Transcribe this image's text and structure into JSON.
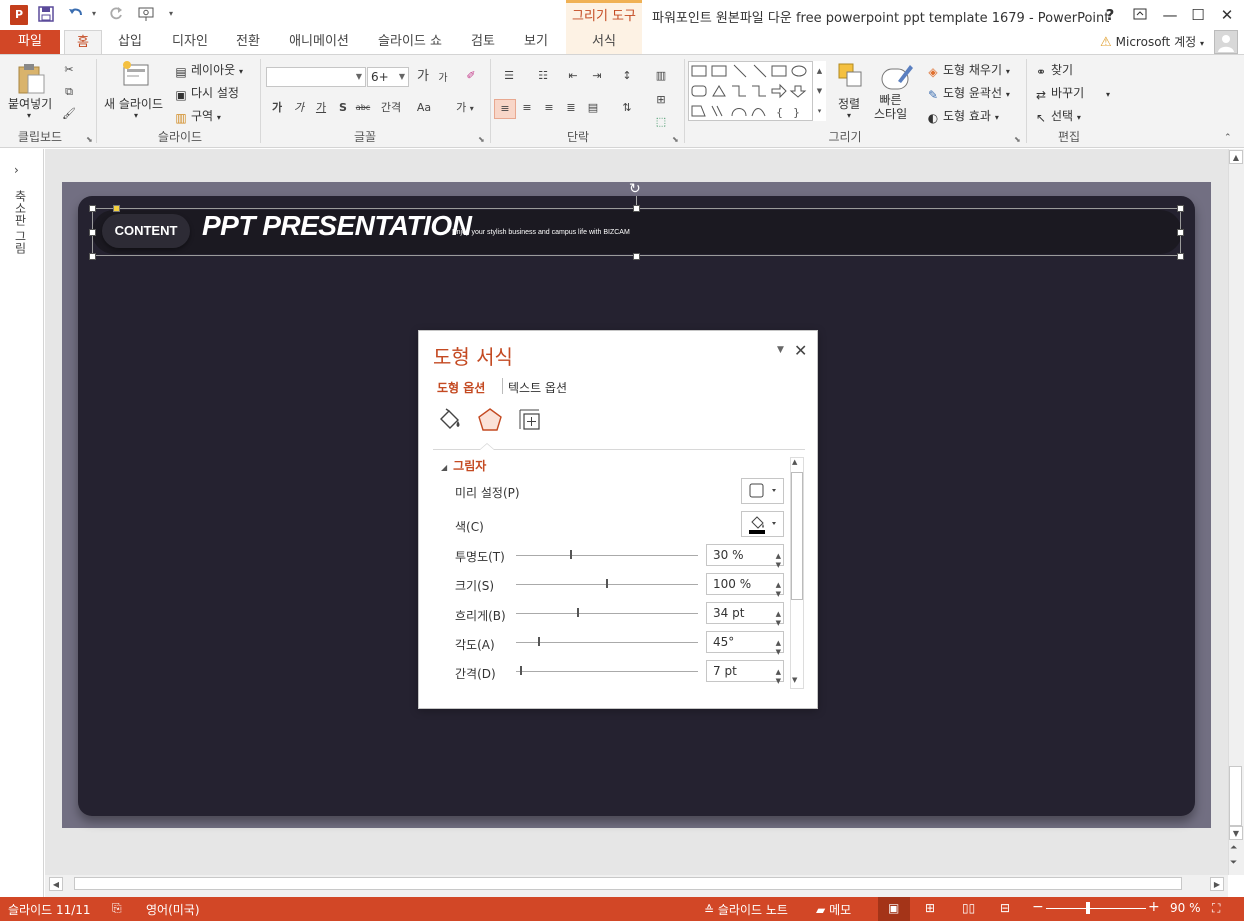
{
  "titlebar": {
    "app_logo": "P",
    "context_group": "그리기 도구",
    "window_title": "파워포인트 원본파일 다운 free powerpoint ppt template 1679 - PowerPoint",
    "help": "?",
    "restore_ribbon": "⧉",
    "minimize": "—",
    "maximize": "☐",
    "close": "✕"
  },
  "tabs": {
    "file": "파일",
    "home": "홈",
    "insert": "삽입",
    "design": "디자인",
    "transitions": "전환",
    "animations": "애니메이션",
    "slideshow": "슬라이드 쇼",
    "review": "검토",
    "view": "보기",
    "format": "서식",
    "account": "Microsoft 계정"
  },
  "ribbon": {
    "clipboard": {
      "paste": "붙여넣기",
      "label": "클립보드"
    },
    "slides": {
      "new_slide": "새 슬라이드",
      "layout": "레이아웃",
      "reset": "다시 설정",
      "section": "구역",
      "label": "슬라이드"
    },
    "font": {
      "font_name": "",
      "font_size": "6+",
      "grow": "가",
      "shrink": "가",
      "bold": "가",
      "italic": "가",
      "underline": "가",
      "shadow": "S",
      "strike": "abc",
      "spacing": "간격",
      "case": "Aa",
      "color": "가",
      "label": "글꼴"
    },
    "paragraph": {
      "label": "단락"
    },
    "drawing": {
      "arrange": "정렬",
      "quick_styles": "빠른\n스타일",
      "fill": "도형 채우기",
      "outline": "도형 윤곽선",
      "effects": "도형 효과",
      "label": "그리기"
    },
    "editing": {
      "find": "찾기",
      "replace": "바꾸기",
      "select": "선택",
      "label": "편집"
    }
  },
  "thumb_pane": {
    "toggle": "›",
    "label": "축소판 그림"
  },
  "slide": {
    "content_pill": "CONTENT",
    "title": "PPT PRESENTATION",
    "subtitle": "Enjoy your stylish business and campus life with BIZCAM"
  },
  "dialog": {
    "title": "도형 서식",
    "pin": "▼",
    "close": "✕",
    "tab_shape": "도형 옵션",
    "tab_text": "텍스트 옵션",
    "section": "그림자",
    "props": {
      "preset": "미리 설정(P)",
      "color": "색(C)",
      "transparency": {
        "label": "투명도(T)",
        "value": "30 %"
      },
      "size": {
        "label": "크기(S)",
        "value": "100 %"
      },
      "blur": {
        "label": "흐리게(B)",
        "value": "34 pt"
      },
      "angle": {
        "label": "각도(A)",
        "value": "45°"
      },
      "distance": {
        "label": "간격(D)",
        "value": "7 pt"
      }
    }
  },
  "statusbar": {
    "slide_info": "슬라이드 11/11",
    "language": "영어(미국)",
    "notes": "슬라이드 노트",
    "comments": "메모",
    "zoom": "90 %",
    "zoom_minus": "−",
    "zoom_plus": "+"
  },
  "colors": {
    "accent": "#d24726",
    "accent_text": "#c44a22",
    "slide_card": "#252230",
    "slide_bg": "#726f82"
  }
}
